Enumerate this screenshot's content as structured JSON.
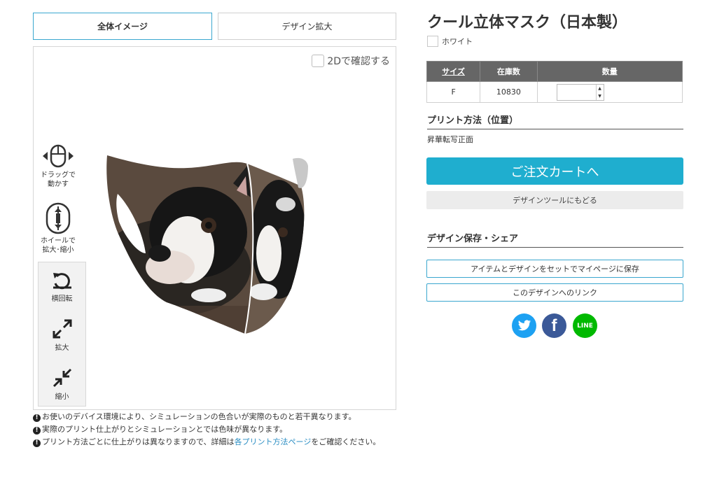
{
  "tabs": {
    "full_image": "全体イメージ",
    "design_zoom": "デザイン拡大"
  },
  "preview": {
    "check_2d_label": "2Dで確認する",
    "hint_drag": "ドラッグで\n動かす",
    "hint_wheel": "ホイールで\n拡大･縮小",
    "tool_rotate": "横回転",
    "tool_zoom_in": "拡大",
    "tool_zoom_out": "縮小"
  },
  "notes": {
    "line1": "お使いのデバイス環境により、シミュレーションの色合いが実際のものと若干異なります。",
    "line2": "実際のプリント仕上がりとシミュレーションとでは色味が異なります。",
    "line3_pre": "プリント方法ごとに仕上がりは異なりますので、詳細は",
    "line3_link": "各プリント方法ページ",
    "line3_post": "をご確認ください。"
  },
  "product": {
    "title": "クール立体マスク（日本製）",
    "color": "ホワイト",
    "table": {
      "headers": [
        "サイズ",
        "在庫数",
        "数量"
      ],
      "rows": [
        {
          "size": "F",
          "stock": "10830",
          "qty": ""
        }
      ]
    },
    "print_method_heading": "プリント方法（位置）",
    "print_method_value": "昇華転写正面",
    "cart_button": "ご注文カートへ",
    "back_button": "デザインツールにもどる",
    "save_heading": "デザイン保存・シェア",
    "save_button": "アイテムとデザインをセットでマイページに保存",
    "link_button": "このデザインへのリンク",
    "share": {
      "line_label": "LINE"
    }
  },
  "colors": {
    "accent": "#1faecf",
    "twitter": "#1da1f2",
    "facebook": "#3b5998",
    "line": "#00b900",
    "table_header": "#666666"
  }
}
